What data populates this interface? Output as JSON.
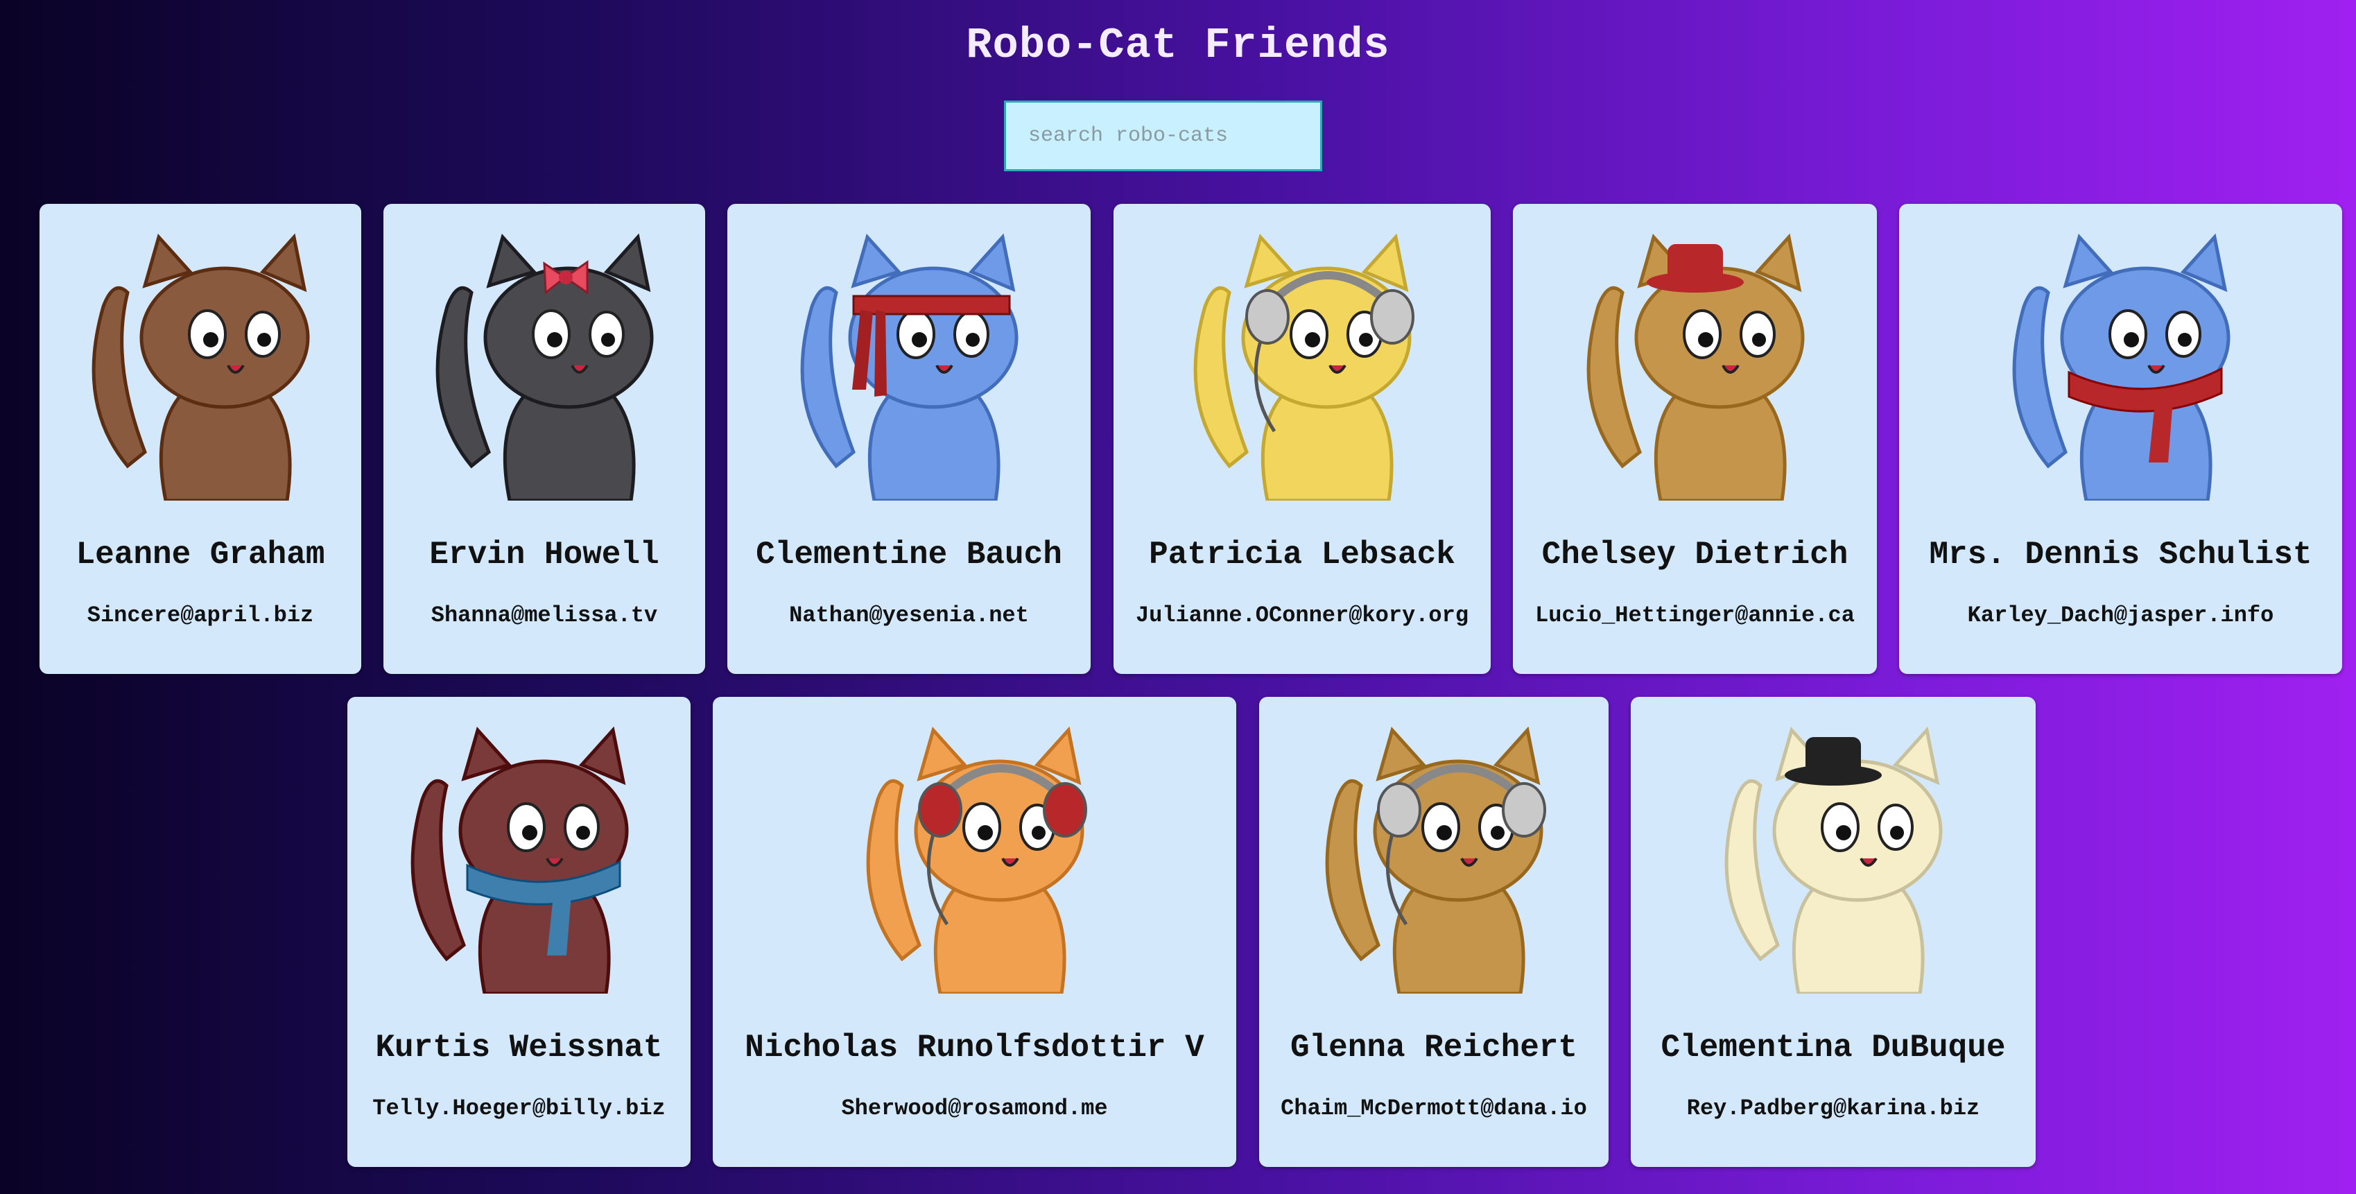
{
  "page": {
    "title": "Robo-Cat Friends",
    "search_placeholder": "search robo-cats"
  },
  "cats": [
    {
      "name": "Leanne Graham",
      "email": "Sincere@april.biz",
      "color": "#8a5a3f",
      "accessory": "none",
      "avatar_icon": "brown-cat-icon"
    },
    {
      "name": "Ervin Howell",
      "email": "Shanna@melissa.tv",
      "color": "#4a4a4e",
      "accessory": "bow",
      "avatar_icon": "gray-cat-with-bow-icon"
    },
    {
      "name": "Clementine Bauch",
      "email": "Nathan@yesenia.net",
      "color": "#6f9ae8",
      "accessory": "headband",
      "avatar_icon": "blue-cat-with-headband-icon"
    },
    {
      "name": "Patricia Lebsack",
      "email": "Julianne.OConner@kory.org",
      "color": "#f2d55c",
      "accessory": "headphones-silver",
      "avatar_icon": "yellow-cat-with-headphones-icon"
    },
    {
      "name": "Chelsey Dietrich",
      "email": "Lucio_Hettinger@annie.ca",
      "color": "#c6954c",
      "accessory": "hat-red",
      "avatar_icon": "tan-cat-with-red-hat-icon"
    },
    {
      "name": "Mrs. Dennis Schulist",
      "email": "Karley_Dach@jasper.info",
      "color": "#6f9ae8",
      "accessory": "scarf-red",
      "avatar_icon": "blue-cat-with-scarf-icon"
    },
    {
      "name": "Kurtis Weissnat",
      "email": "Telly.Hoeger@billy.biz",
      "color": "#7a3a3a",
      "accessory": "scarf-blue",
      "avatar_icon": "maroon-cat-with-blue-scarf-icon"
    },
    {
      "name": "Nicholas Runolfsdottir V",
      "email": "Sherwood@rosamond.me",
      "color": "#f0a04e",
      "accessory": "headphones-red",
      "avatar_icon": "orange-cat-with-headphones-icon"
    },
    {
      "name": "Glenna Reichert",
      "email": "Chaim_McDermott@dana.io",
      "color": "#c6954c",
      "accessory": "headphones-silver",
      "avatar_icon": "tan-cat-with-headphones-icon"
    },
    {
      "name": "Clementina DuBuque",
      "email": "Rey.Padberg@karina.biz",
      "color": "#f5eec8",
      "accessory": "hat-black",
      "avatar_icon": "cream-cat-with-top-hat-icon"
    }
  ]
}
